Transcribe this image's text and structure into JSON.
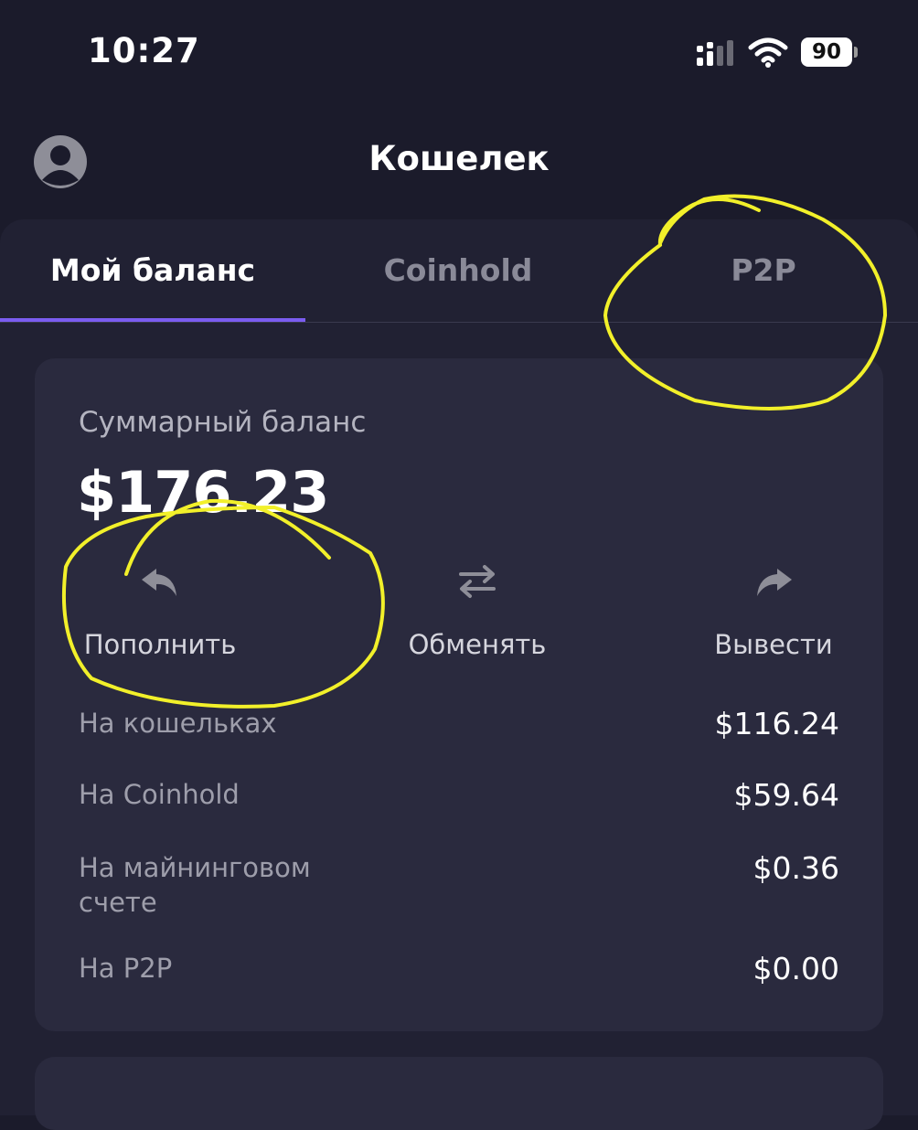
{
  "status_bar": {
    "time": "10:27",
    "battery": "90",
    "signal_icon": "cellular-signal-icon",
    "wifi_icon": "wifi-icon"
  },
  "header": {
    "title": "Кошелек",
    "avatar_icon": "user-avatar-icon"
  },
  "tabs": [
    {
      "label": "Мой баланс",
      "active": true
    },
    {
      "label": "Coinhold",
      "active": false
    },
    {
      "label": "P2P",
      "active": false
    }
  ],
  "balance": {
    "label": "Суммарный баланс",
    "amount": "$176.23"
  },
  "actions": [
    {
      "label": "Пополнить",
      "icon": "reply-arrow-icon"
    },
    {
      "label": "Обменять",
      "icon": "swap-arrows-icon"
    },
    {
      "label": "Вывести",
      "icon": "forward-arrow-icon"
    }
  ],
  "breakdown": [
    {
      "label": "На кошельках",
      "value": "$116.24"
    },
    {
      "label": "На Coinhold",
      "value": "$59.64"
    },
    {
      "label": "На майнинговом счете",
      "value": "$0.36"
    },
    {
      "label": "На P2P",
      "value": "$0.00"
    }
  ],
  "colors": {
    "background": "#1b1b2b",
    "panel": "#212133",
    "card": "#2a2a3e",
    "accent": "#7b5cf0",
    "annotation": "#f2f02a"
  }
}
